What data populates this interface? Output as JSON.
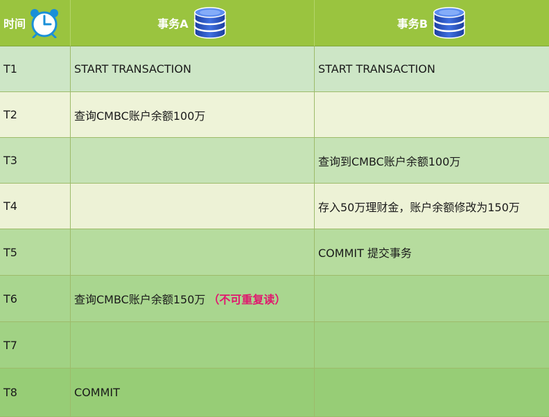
{
  "header": {
    "time_label": "时间",
    "col_a_label": "事务A",
    "col_b_label": "事务B",
    "clock_icon": "alarm-clock-icon",
    "db_icon": "database-icon",
    "header_color": "#9ac43f"
  },
  "rows": [
    {
      "time": "T1",
      "a": "START TRANSACTION",
      "b": "START TRANSACTION"
    },
    {
      "time": "T2",
      "a": "查询CMBC账户余额100万",
      "b": ""
    },
    {
      "time": "T3",
      "a": "",
      "b": "查询到CMBC账户余额100万"
    },
    {
      "time": "T4",
      "a": "",
      "b": "存入50万理财金，账户余额修改为150万"
    },
    {
      "time": "T5",
      "a": "",
      "b": "COMMIT 提交事务"
    },
    {
      "time": "T6",
      "a": "查询CMBC账户余额150万",
      "a_note": "（不可重复读）",
      "b": ""
    },
    {
      "time": "T7",
      "a": "",
      "b": ""
    },
    {
      "time": "T8",
      "a": "COMMIT",
      "b": ""
    }
  ],
  "colors": {
    "note_color": "#e0186e"
  }
}
